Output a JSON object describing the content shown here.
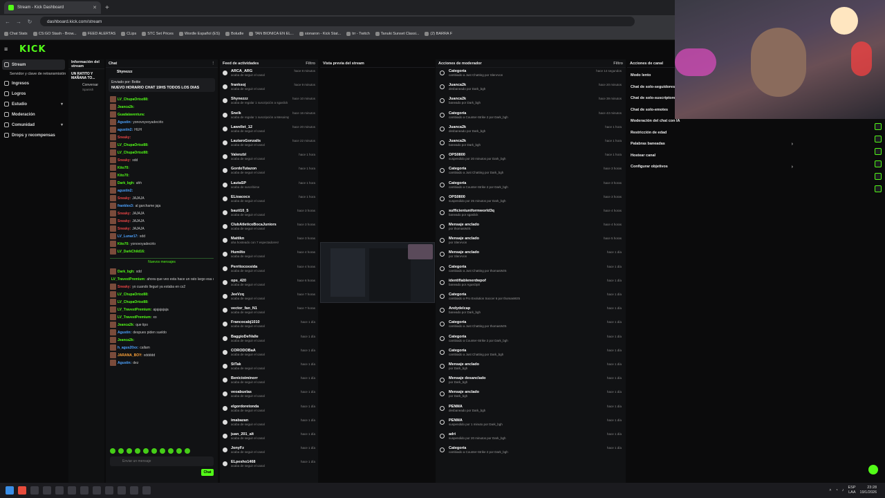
{
  "browser": {
    "tab_title": "Stream - Kick Dashboard",
    "url": "dashboard.kick.com/stream",
    "bookmarks": [
      "Chat Stats",
      "CS:GO Stash - Brow...",
      "FEED ALERTAS",
      "CLips",
      "STC Set Prices",
      "Wordle Español (ES)",
      "Boludle",
      "TAN BIONICA EN EL...",
      "sionaron - Kick Stat...",
      "trr - Twitch",
      "Tanuki Sunset Classi...",
      "(2) BARRA F"
    ]
  },
  "app": {
    "logo": "KICK"
  },
  "sidebar": {
    "items": [
      {
        "label": "Stream",
        "active": true
      },
      {
        "label": "Servidor y clave de retransmisión",
        "sub": true
      },
      {
        "label": "Ingresos"
      },
      {
        "label": "Logros"
      },
      {
        "label": "Estudio",
        "chev": "▾"
      },
      {
        "label": "Moderación"
      },
      {
        "label": "Comunidad",
        "chev": "▾"
      },
      {
        "label": "Drops y recompensas"
      }
    ]
  },
  "info_panel": {
    "title": "Información del stream",
    "stream_title": "UN RATITO Y MAÑANA TO...",
    "category": "Conversar",
    "language": "Spanish"
  },
  "chat": {
    "title": "Chat",
    "pinned_by": "Enviado por: Bottie",
    "pinned_text": "NUEVO HORARIO CHAT 19HS TODOS LOS DIAS",
    "top_user": "Shynezzz",
    "lines": [
      {
        "u": "LV_ChupaOrtoz88:",
        "c": "",
        "t": ""
      },
      {
        "u": "Jeanca2k:",
        "c": "",
        "t": ""
      },
      {
        "u": "Guadalaventura:",
        "c": "",
        "t": ""
      },
      {
        "u": "Agustin:",
        "c": "blue",
        "t": "yonovoyvoyadecirlo"
      },
      {
        "u": "agustin2:",
        "c": "blue",
        "t": "HUH"
      },
      {
        "u": "Sneaky:",
        "c": "red",
        "t": ""
      },
      {
        "u": "LV_ChupaOrtoz88:",
        "c": "",
        "t": ""
      },
      {
        "u": "LV_ChupaOrtoz88:",
        "c": "",
        "t": ""
      },
      {
        "u": "Sneaky:",
        "c": "red",
        "t": "xdd"
      },
      {
        "u": "Kito70:",
        "c": "",
        "t": ""
      },
      {
        "u": "Kito70:",
        "c": "",
        "t": ""
      },
      {
        "u": "Dark_bgh:",
        "c": "",
        "t": "ahh"
      },
      {
        "u": "agustin2:",
        "c": "blue",
        "t": ""
      },
      {
        "u": "Sneaky:",
        "c": "red",
        "t": "JAJAJA"
      },
      {
        "u": "franklex3:",
        "c": "blue",
        "t": "al garchame jaja"
      },
      {
        "u": "Sneaky:",
        "c": "red",
        "t": "JAJAJA"
      },
      {
        "u": "Sneaky:",
        "c": "red",
        "t": "JAJAJA"
      },
      {
        "u": "Sneaky:",
        "c": "red",
        "t": "JAJAJA"
      },
      {
        "u": "LV_Lunar17:",
        "c": "blue",
        "t": "xdd"
      },
      {
        "u": "Kito70:",
        "c": "",
        "t": "yonovoyadecirlo"
      },
      {
        "u": "LV_DarkChild16:",
        "c": "",
        "t": ""
      }
    ],
    "new_messages": "Nuevos mensajes",
    "lines2": [
      {
        "u": "Dark_bgh:",
        "c": "",
        "t": "xdd"
      },
      {
        "u": "LV_TravestPremium:",
        "c": "",
        "t": "ahora que veo esta hace un rato largo esa categoria"
      },
      {
        "u": "Sneaky:",
        "c": "red",
        "t": "yo cuando llegué ya estaba en cs2"
      },
      {
        "u": "LV_ChupaOrtoz88:",
        "c": "",
        "t": ""
      },
      {
        "u": "LV_ChupaOrtoz88:",
        "c": "",
        "t": ""
      },
      {
        "u": "LV_TravestPremium:",
        "c": "",
        "t": "ajajajajaja"
      },
      {
        "u": "LV_TravestPremium:",
        "c": "",
        "t": "xo"
      },
      {
        "u": "Jeanca2k:",
        "c": "",
        "t": "que tipo"
      },
      {
        "u": "Agustin:",
        "c": "blue",
        "t": "despues piden sueldo"
      },
      {
        "u": "Jeanca2k:",
        "c": "",
        "t": ""
      },
      {
        "u": "h_agus20xx:",
        "c": "blue",
        "t": "callam"
      },
      {
        "u": "JARANA_BOY:",
        "c": "org",
        "t": "xddddd"
      },
      {
        "u": "Agustin:",
        "c": "blue",
        "t": "dez"
      }
    ],
    "input_placeholder": "Enviar un mensaje",
    "send_label": "Chat"
  },
  "feed": {
    "title": "Feed de actividades",
    "filter": "Filtro",
    "rows": [
      {
        "n": "ARCA_ARG",
        "d": "acaba de seguir el canal",
        "tm": "hace 8 minutos"
      },
      {
        "n": "franksoj",
        "d": "acaba de seguir el canal",
        "tm": "hace 9 minutos"
      },
      {
        "n": "Shynezzz",
        "d": "acaba de regalar 1 suscripción a sgaslick",
        "tm": "hace 10 minutos"
      },
      {
        "n": "Snelk",
        "d": "acaba de regalar 1 suscripción a Mesoimplotado",
        "tm": "hace 16 minutos"
      },
      {
        "n": "Lawellet_12",
        "d": "acaba de seguir el canal",
        "tm": "hace 20 minutos"
      },
      {
        "n": "LautaroGonzalis",
        "d": "acaba de seguir el canal",
        "tm": "hace 22 minutos"
      },
      {
        "n": "Valenzbl",
        "d": "acaba de seguir el canal",
        "tm": "hace 1 hora"
      },
      {
        "n": "GordoTutazon",
        "d": "acaba de seguir el canal",
        "tm": "hace 1 hora"
      },
      {
        "n": "LautaSP",
        "d": "acaba de suscribirse",
        "tm": "hace 1 hora"
      },
      {
        "n": "ELioacocx",
        "d": "acaba de seguir el canal",
        "tm": "hace 1 hora"
      },
      {
        "n": "bauti10_5",
        "d": "acaba de seguir el canal",
        "tm": "hace 3 horas"
      },
      {
        "n": "ClubAtleticoBocaJuniors",
        "d": "acaba de seguir el canal",
        "tm": "hace 3 horas"
      },
      {
        "n": "Mattikn",
        "d": "aha hosteado con 7 espectadores!",
        "tm": "hace 3 horas"
      },
      {
        "n": "Humilto",
        "d": "acaba de seguir el canal",
        "tm": "hace 4 horas"
      },
      {
        "n": "Perritocoxsida",
        "d": "acaba de seguir el canal",
        "tm": "hace 4 horas"
      },
      {
        "n": "ops_420",
        "d": "acaba de seguir el canal",
        "tm": "hace 6 horas"
      },
      {
        "n": "JeeVzq",
        "d": "acaba de seguir el canal",
        "tm": "hace 7 horas"
      },
      {
        "n": "vector_fan_N1",
        "d": "acaba de seguir el canal",
        "tm": "hace 7 horas"
      },
      {
        "n": "Francocabj1010",
        "d": "acaba de seguir el canal",
        "tm": "hace 1 día"
      },
      {
        "n": "BaggioDelValle",
        "d": "acaba de seguir el canal",
        "tm": "hace 1 día"
      },
      {
        "n": "CORODOBaA",
        "d": "acaba de seguir el canal",
        "tm": "hace 1 día"
      },
      {
        "n": "StTak",
        "d": "acaba de seguir el canal",
        "tm": "hace 1 día"
      },
      {
        "n": "Benicioiminorr",
        "d": "acaba de seguir el canal",
        "tm": "hace 1 día"
      },
      {
        "n": "veoabuelas",
        "d": "acaba de seguir el canal",
        "tm": "hace 1 día"
      },
      {
        "n": "elgordoretonda",
        "d": "acaba de seguir el canal",
        "tm": "hace 1 día"
      },
      {
        "n": "imabazan",
        "d": "acaba de seguir el canal",
        "tm": "hace 1 día"
      },
      {
        "n": "juan_201_alt",
        "d": "acaba de seguir el canal",
        "tm": "hace 1 día"
      },
      {
        "n": "JonyFz",
        "d": "acaba de seguir el canal",
        "tm": "hace 1 día"
      },
      {
        "n": "ELpesho1468",
        "d": "acaba de seguir el canal",
        "tm": "hace 1 día"
      }
    ]
  },
  "preview": {
    "title": "Vista previa del stream"
  },
  "mod": {
    "title": "Acciones de moderador",
    "filter": "Filtro",
    "rows": [
      {
        "n": "Categoría",
        "d": "cambiado a Just Chatting por SlenAron",
        "tm": "hace 14 segundos"
      },
      {
        "n": "Juanca2k",
        "d": "desbaneado por Dark_bgh",
        "tm": "hace 20 minutos"
      },
      {
        "n": "Juanca2k",
        "d": "baneado por Dark_bgh",
        "tm": "hace 39 minutos"
      },
      {
        "n": "Categoría",
        "d": "cambiado a Counter-Strike 2 por Dark_bgh",
        "tm": "hace 43 minutos"
      },
      {
        "n": "Juanca2k",
        "d": "desbaneado por Dark_bgh",
        "tm": "hace 1 hora"
      },
      {
        "n": "Juanca2k",
        "d": "baneado por Dark_bgh",
        "tm": "hace 1 hora"
      },
      {
        "n": "OPS0800",
        "d": "suspendido por 20 minutos por Dark_bgh",
        "tm": "hace 1 hora"
      },
      {
        "n": "Categoría",
        "d": "cambiado a Just Chatting por Dark_bgh",
        "tm": "hace 3 horas"
      },
      {
        "n": "Categoría",
        "d": "cambiado a Counter-Strike 2 por Dark_bgh",
        "tm": "hace 3 horas"
      },
      {
        "n": "OPS0800",
        "d": "suspendido por 25 minutos por Dark_bgh",
        "tm": "hace 3 horas"
      },
      {
        "n": "sufficientuniformworld3q",
        "d": "baneado por sgaslick",
        "tm": "hace 4 horas"
      },
      {
        "n": "Mensaje anclado",
        "d": "por thomasWz5",
        "tm": "hace 4 horas"
      },
      {
        "n": "Mensaje anclado",
        "d": "por SlenAron",
        "tm": "hace 5 horas"
      },
      {
        "n": "Mensaje anclado",
        "d": "por SlenAron",
        "tm": "hace 1 día"
      },
      {
        "n": "Categoría",
        "d": "cambiado a Just Chatting por thomasWz5",
        "tm": "hace 1 día"
      },
      {
        "n": "identifiablenerdwpof",
        "d": "baneado por AgusOp0",
        "tm": "hace 1 día"
      },
      {
        "n": "Categoría",
        "d": "cambiado a Pro Evolution Soccer 6 por thomasWz5",
        "tm": "hace 1 día"
      },
      {
        "n": "Andydelcap",
        "d": "baneado por Dark_bgh",
        "tm": "hace 1 día"
      },
      {
        "n": "Categoría",
        "d": "cambiado a Just Chatting por thomasWz5",
        "tm": "hace 1 día"
      },
      {
        "n": "Categoría",
        "d": "cambiado a Counter-Strike 2 por Dark_bgh",
        "tm": "hace 1 día"
      },
      {
        "n": "Categoría",
        "d": "cambiado a Just Chatting por Dark_bgh",
        "tm": "hace 1 día"
      },
      {
        "n": "Mensaje anclado",
        "d": "por Dark_bgh",
        "tm": "hace 1 día"
      },
      {
        "n": "Mensaje desanclado",
        "d": "por Dark_bgh",
        "tm": "hace 1 día"
      },
      {
        "n": "Mensaje anclado",
        "d": "por Dark_bgh",
        "tm": "hace 1 día"
      },
      {
        "n": "PENMA",
        "d": "desbaneado por Dark_bgh",
        "tm": "hace 1 día"
      },
      {
        "n": "PENMA",
        "d": "suspendido por 1 minuto por Dark_bgh",
        "tm": "hace 1 día"
      },
      {
        "n": "adri",
        "d": "suspendido por 20 minutos por Dark_bgh",
        "tm": "hace 1 día"
      },
      {
        "n": "Categoría",
        "d": "cambiado a Counter-Strike 2 por Dark_bgh",
        "tm": "hace 1 día"
      }
    ]
  },
  "channel": {
    "title": "Acciones de canal",
    "items": [
      {
        "label": "Modo lento"
      },
      {
        "label": "Chat de solo-seguidores"
      },
      {
        "label": "Chat de solo-suscriptores"
      },
      {
        "label": "Chat de solo-emotes"
      },
      {
        "label": "Moderación del chat con IA"
      },
      {
        "label": "Restricción de edad"
      },
      {
        "label": "Palabras baneadas",
        "arr": "›"
      },
      {
        "label": "Hostear canal"
      },
      {
        "label": "Configurar objetivos",
        "arr": "›"
      }
    ]
  },
  "taskbar": {
    "lang": "ESP",
    "lang2": "LAA",
    "time": "23:28",
    "date": "19/1/2026"
  }
}
